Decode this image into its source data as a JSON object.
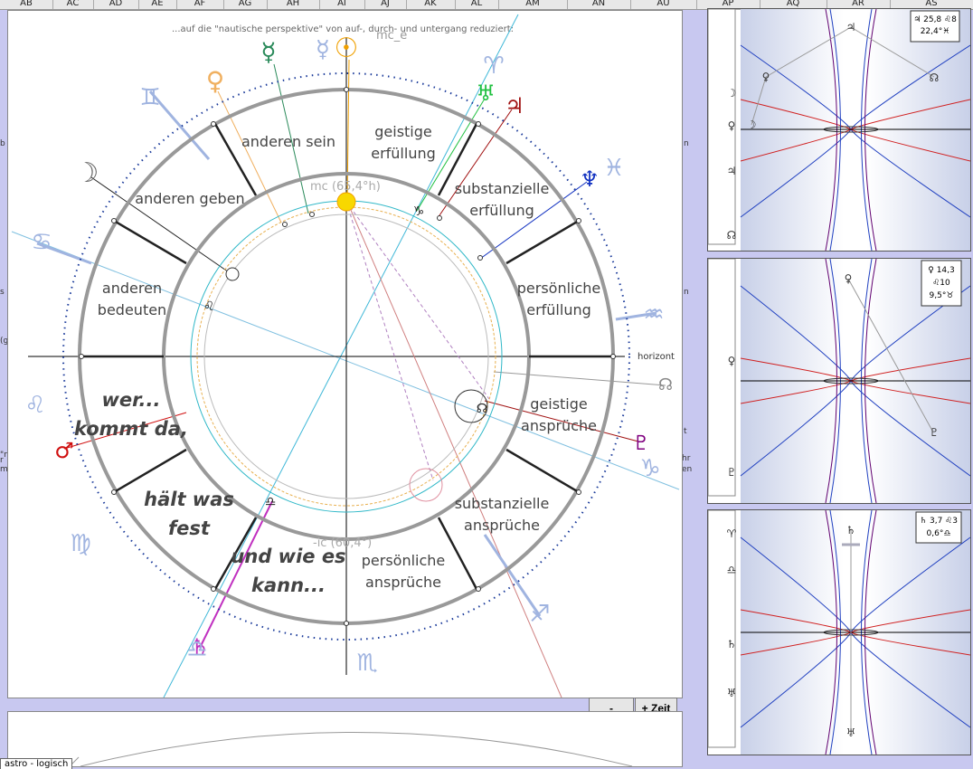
{
  "columns": [
    "AB",
    "AC",
    "AD",
    "AE",
    "AF",
    "AG",
    "AH",
    "AI",
    "AJ",
    "AK",
    "AL",
    "AM",
    "AN",
    "AU",
    "AP",
    "AQ",
    "AR",
    "AS"
  ],
  "caption": "...auf die \"nautische perspektive\" von auf-, durch- und untergang reduziert:",
  "mc_top": "mc_e",
  "mc_label": "mc (65,4°h)",
  "ic_label": "-ic (60,4°)",
  "horizon_label": "horizont",
  "houses": {
    "h1a": "anderen sein",
    "h2a": "geistige",
    "h2b": "erfüllung",
    "h3": "anderen geben",
    "h4a": "substanzielle",
    "h4b": "erfüllung",
    "h5a": "anderen",
    "h5b": "bedeuten",
    "h6a": "persönliche",
    "h6b": "erfüllung",
    "h7a": "geistige",
    "h7b": "ansprüche",
    "h8a": "substanzielle",
    "h8b": "ansprüche",
    "h9a": "persönliche",
    "h9b": "ansprüche"
  },
  "phrases": {
    "p1": "wer...",
    "p2": "kommt da,",
    "p3": "hält was",
    "p4": "fest",
    "p5": "und wie es",
    "p6": "kann..."
  },
  "glyphs": {
    "sun": "☉",
    "mercury": "☿",
    "venus": "♀",
    "moon": "☽",
    "mars": "♂",
    "jupiter": "♃",
    "saturn": "♄",
    "uranus": "♅",
    "neptune": "♆",
    "pluto": "♇",
    "node": "☊",
    "gemini": "♊",
    "aries": "♈",
    "pisces": "♓",
    "cancer": "♋",
    "aquarius": "♒",
    "leo": "♌",
    "capricorn": "♑",
    "virgo": "♍",
    "sagittarius": "♐",
    "libra": "♎",
    "scorpio": "♏",
    "taurus": "♉"
  },
  "buttons": {
    "minus": "-",
    "plus_zeit": "+ Zeit"
  },
  "tab_label": "astro - logisch",
  "side_panels": [
    {
      "info1": "♃ 25,8 ♌8",
      "info2": "22,4°♓"
    },
    {
      "info1": "♀ 14,3",
      "info2": "♌10",
      "info3": "9,5°♉"
    },
    {
      "info1": "♄ 3,7 ♌3",
      "info2": "0,6°♎"
    }
  ],
  "left_edge": [
    "b",
    "s",
    "(g",
    "\"n",
    "r",
    "m"
  ],
  "right_edge": [
    "n",
    "n",
    "t",
    "hr",
    "en"
  ],
  "colors": {
    "sun": "#f0a000",
    "mercury": "#2a8a5a",
    "venus": "#f0b060",
    "mars": "#d01010",
    "jupiter": "#a01010",
    "uranus": "#20c040",
    "neptune": "#1030c0",
    "pluto": "#800080",
    "saturn": "#c030c0",
    "ring": "#999999",
    "zodiac": "#a0b4e0"
  }
}
